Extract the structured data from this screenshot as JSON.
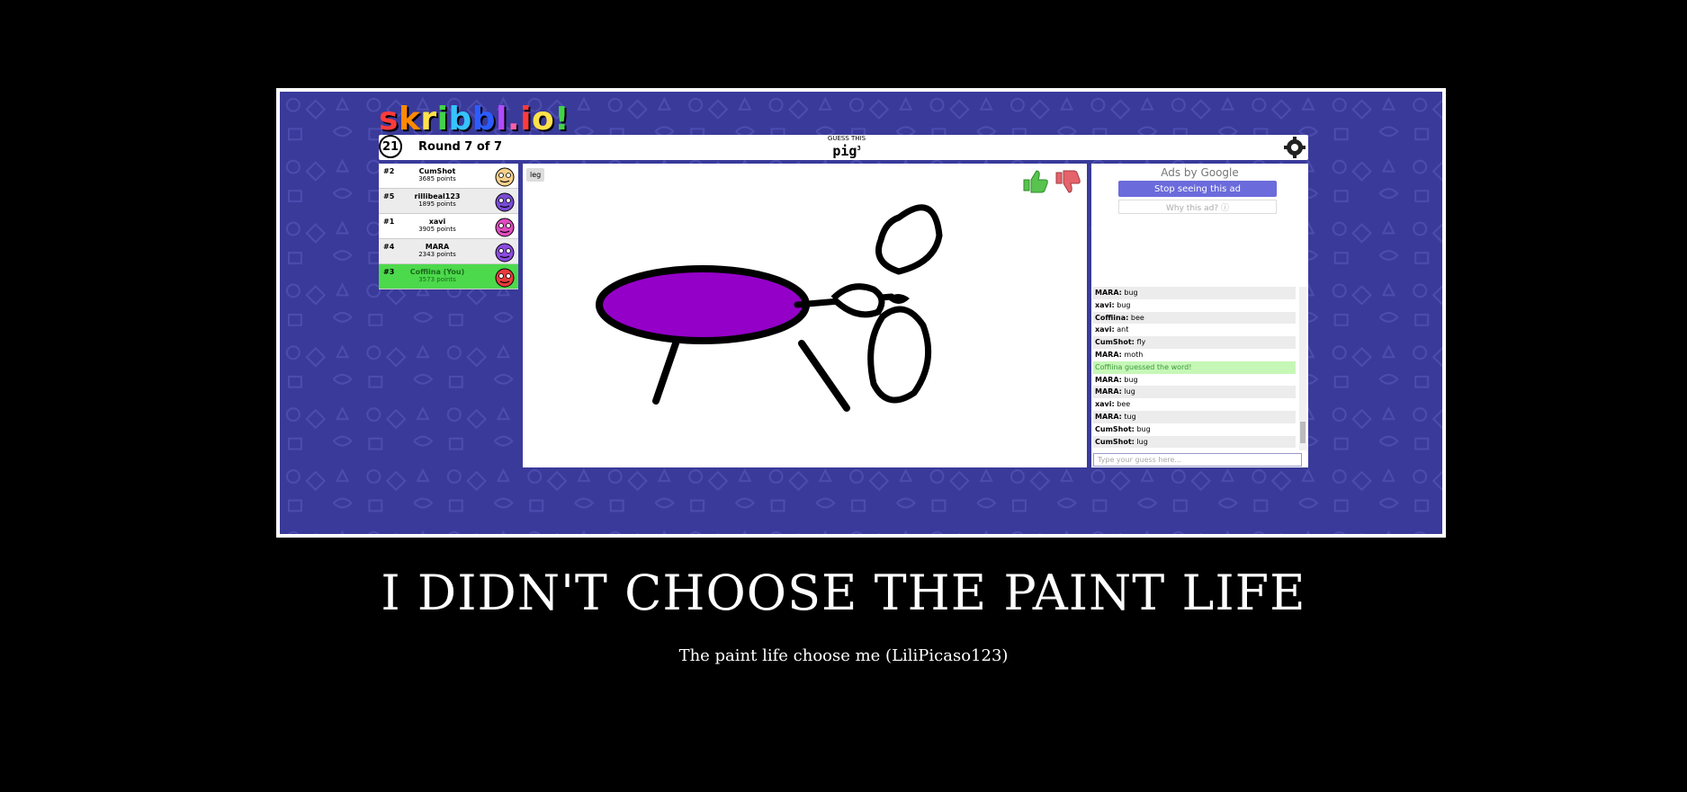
{
  "game": {
    "logo": [
      "s",
      "k",
      "r",
      "i",
      "b",
      "b",
      "l",
      ".",
      "i",
      "o",
      "!"
    ],
    "logo_colors": [
      "#ff3b3b",
      "#ff8a00",
      "#ffe14a",
      "#44d24a",
      "#35c3ff",
      "#2c5cff",
      "#b24bff",
      "#ff5fa8",
      "#ff3b3b",
      "#ffe14a",
      "#44d24a"
    ],
    "timer": "21",
    "round_label": "Round 7 of 7",
    "guess_title": "GUESS THIS",
    "word": "pig",
    "word_superscript": "3",
    "hint_tag": "leg"
  },
  "players": [
    {
      "rank": "#2",
      "name": "CumShot",
      "points": "3685 points",
      "color": "#f5d08a",
      "you": false
    },
    {
      "rank": "#5",
      "name": "rillibeal123",
      "points": "1895 points",
      "color": "#7a4bd6",
      "you": false
    },
    {
      "rank": "#1",
      "name": "xavi",
      "points": "3905 points",
      "color": "#e04bbf",
      "you": false
    },
    {
      "rank": "#4",
      "name": "MARA",
      "points": "2343 points",
      "color": "#8c4be0",
      "you": false
    },
    {
      "rank": "#3",
      "name": "Coffiina (You)",
      "points": "3573 points",
      "color": "#e83b3b",
      "you": true
    }
  ],
  "ads": {
    "title": "Ads by Google",
    "stop_label": "Stop seeing this ad",
    "why_label": "Why this ad? ⓘ"
  },
  "chat": [
    {
      "user": "MARA:",
      "text": "bug",
      "correct": false
    },
    {
      "user": "xavi:",
      "text": "bug",
      "correct": false
    },
    {
      "user": "Coffiina:",
      "text": "bee",
      "correct": false
    },
    {
      "user": "xavi:",
      "text": "ant",
      "correct": false
    },
    {
      "user": "CumShot:",
      "text": "fly",
      "correct": false
    },
    {
      "user": "MARA:",
      "text": "moth",
      "correct": false
    },
    {
      "user": "",
      "text": "Coffiina guessed the word!",
      "correct": true
    },
    {
      "user": "MARA:",
      "text": "bug",
      "correct": false
    },
    {
      "user": "MARA:",
      "text": "lug",
      "correct": false
    },
    {
      "user": "xavi:",
      "text": "bee",
      "correct": false
    },
    {
      "user": "MARA:",
      "text": "tug",
      "correct": false
    },
    {
      "user": "CumShot:",
      "text": "bug",
      "correct": false
    },
    {
      "user": "CumShot:",
      "text": "lug",
      "correct": false
    }
  ],
  "chat_placeholder": "Type your guess here...",
  "poster": {
    "title": "I DIDN'T CHOOSE THE PAINT LIFE",
    "subtitle": "The paint life choose me (LiliPicaso123)"
  }
}
